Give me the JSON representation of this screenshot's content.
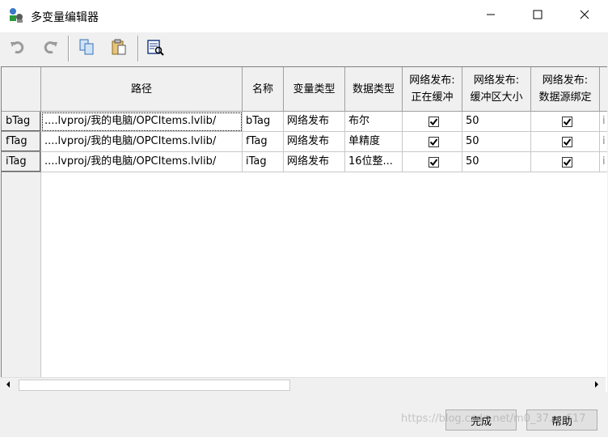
{
  "window": {
    "title": "多变量编辑器",
    "minimize_icon": "minimize-icon",
    "maximize_icon": "maximize-icon",
    "close_icon": "close-icon"
  },
  "toolbar": {
    "icons": [
      "undo-icon",
      "redo-icon",
      "copy-icon",
      "paste-icon",
      "browse-icon"
    ]
  },
  "table": {
    "columns": [
      "路径",
      "名称",
      "变量类型",
      "数据类型",
      "网络发布:\n正在缓冲",
      "网络发布:\n缓冲区大小",
      "网络发布:\n数据源绑定"
    ],
    "col1_label": "路径",
    "col2_label": "名称",
    "col3_label": "变量类型",
    "col4_label": "数据类型",
    "col5_line1": "网络发布:",
    "col5_line2": "正在缓冲",
    "col6_line1": "网络发布:",
    "col6_line2": "缓冲区大小",
    "col7_line1": "网络发布:",
    "col7_line2": "数据源绑定",
    "rows": [
      {
        "header": "bTag",
        "path": "....lvproj/我的电脑/OPCItems.lvlib/",
        "name": "bTag",
        "var_type": "网络发布",
        "data_type": "布尔",
        "buffering": true,
        "buffer_size": "50",
        "binding": true,
        "extra": "i"
      },
      {
        "header": "fTag",
        "path": "....lvproj/我的电脑/OPCItems.lvlib/",
        "name": "fTag",
        "var_type": "网络发布",
        "data_type": "单精度",
        "buffering": true,
        "buffer_size": "50",
        "binding": true,
        "extra": "i"
      },
      {
        "header": "iTag",
        "path": "....lvproj/我的电脑/OPCItems.lvlib/",
        "name": "iTag",
        "var_type": "网络发布",
        "data_type": "16位整...",
        "buffering": true,
        "buffer_size": "50",
        "binding": true,
        "extra": "i"
      }
    ]
  },
  "buttons": {
    "done": "完成",
    "help": "帮助"
  },
  "watermark": "https://blog.csdn.net/m0_37.....617"
}
